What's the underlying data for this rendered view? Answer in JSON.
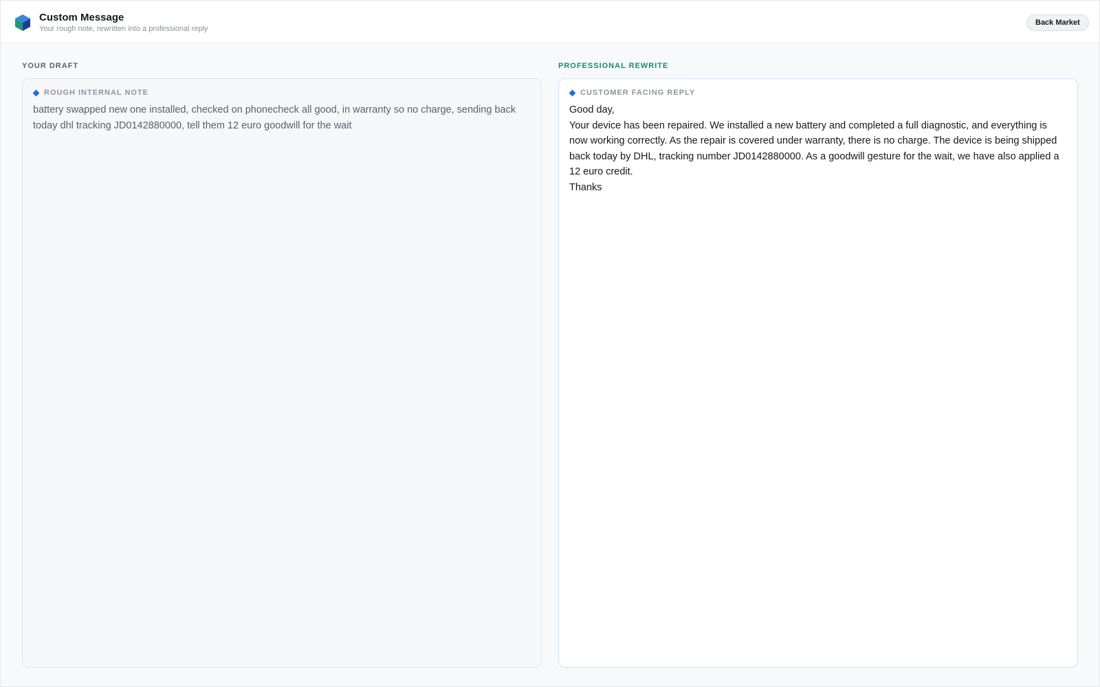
{
  "header": {
    "title": "Custom Message",
    "subtitle": "Your rough note, rewritten into a professional reply",
    "back_button": "Back Market",
    "logo_icon": "cube-logo-icon"
  },
  "draft": {
    "section_label": "YOUR DRAFT",
    "panel_label": "ROUGH INTERNAL NOTE",
    "text": "battery swapped new one installed, checked on phonecheck all good, in warranty so no charge, sending back today dhl tracking JD0142880000, tell them 12 euro goodwill for the wait"
  },
  "rewrite": {
    "section_label": "PROFESSIONAL REWRITE",
    "panel_label": "CUSTOMER FACING REPLY",
    "greeting": "Good day,",
    "body": "Your device has been repaired. We installed a new battery and completed a full diagnostic, and everything is now working correctly. As the repair is covered under warranty, there is no charge. The device is being shipped back today by DHL, tracking number JD0142880000. As a goodwill gesture for the wait, we have also applied a 12 euro credit.",
    "signoff": "Thanks"
  },
  "colors": {
    "accent_blue": "#1f6fd6",
    "accent_green": "#1a8b63"
  }
}
